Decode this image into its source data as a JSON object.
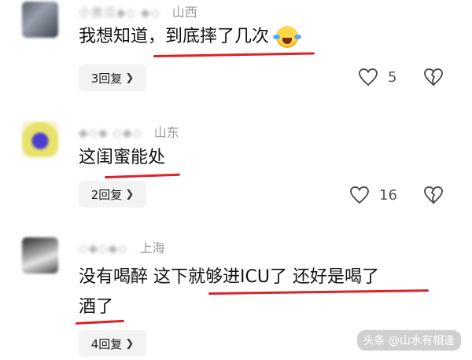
{
  "colors": {
    "underline": "#d8242a",
    "text": "#111111",
    "meta": "#9a9a9a",
    "reply_bg": "#f3f3f3"
  },
  "comments": [
    {
      "name_blurred": "小黄瓜◆◇ ◆◇",
      "location": "山西",
      "text": "我想知道，到底摔了几次",
      "emoji": "rofl-emoji",
      "reply_label": "3回复",
      "likes": "5"
    },
    {
      "name_blurred": "◆◇◆ ◇◆◇",
      "location": "山东",
      "text": "这闺蜜能处",
      "reply_label": "2回复",
      "likes": "16"
    },
    {
      "name_blurred": "◇◆◇◆◇",
      "location": "上海",
      "text_line1": "没有喝醉 这下就够进ICU了 还好是喝了",
      "text_line2": "酒了",
      "reply_label": "4回复",
      "likes": ""
    }
  ],
  "watermark": "头条 @山水有相逢"
}
